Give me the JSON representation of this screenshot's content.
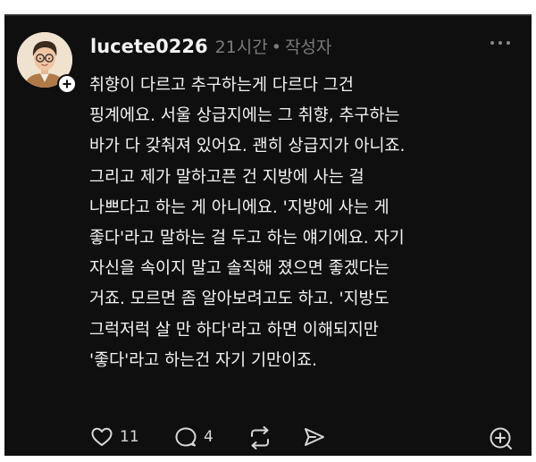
{
  "post": {
    "username": "lucete0226",
    "time": "21시간",
    "separator": "•",
    "author_tag": "작성자",
    "body_lines": [
      "취향이 다르고 추구하는게 다르다 그건",
      "핑계에요. 서울 상급지에는 그 취향, 추구하는",
      "바가 다 갖춰져 있어요. 괜히 상급지가 아니죠.",
      "그리고 제가 말하고픈 건 지방에 사는 걸",
      "나쁘다고 하는 게 아니에요. '지방에 사는 게",
      "좋다'라고 말하는 걸 두고 하는 얘기에요. 자기",
      "자신을 속이지 말고 솔직해 졌으면 좋겠다는",
      "거죠. 모르면 좀 알아보려고도 하고. '지방도",
      "그럭저럭 살 만 하다'라고 하면 이해되지만",
      "'좋다'라고 하는건 자기 기만이죠."
    ]
  },
  "actions": {
    "like_count": "11",
    "reply_count": "4"
  },
  "icons": {
    "avatar": "cartoon-man-with-glasses-avatar",
    "follow": "plus-icon",
    "more": "more-horizontal-icon",
    "like": "heart-icon",
    "reply": "comment-icon",
    "repost": "repost-icon",
    "share": "send-icon",
    "add": "add-circle-icon"
  },
  "colors": {
    "background": "#0f0f0f",
    "text": "#f4f4f4",
    "muted": "#7a7a7a"
  }
}
